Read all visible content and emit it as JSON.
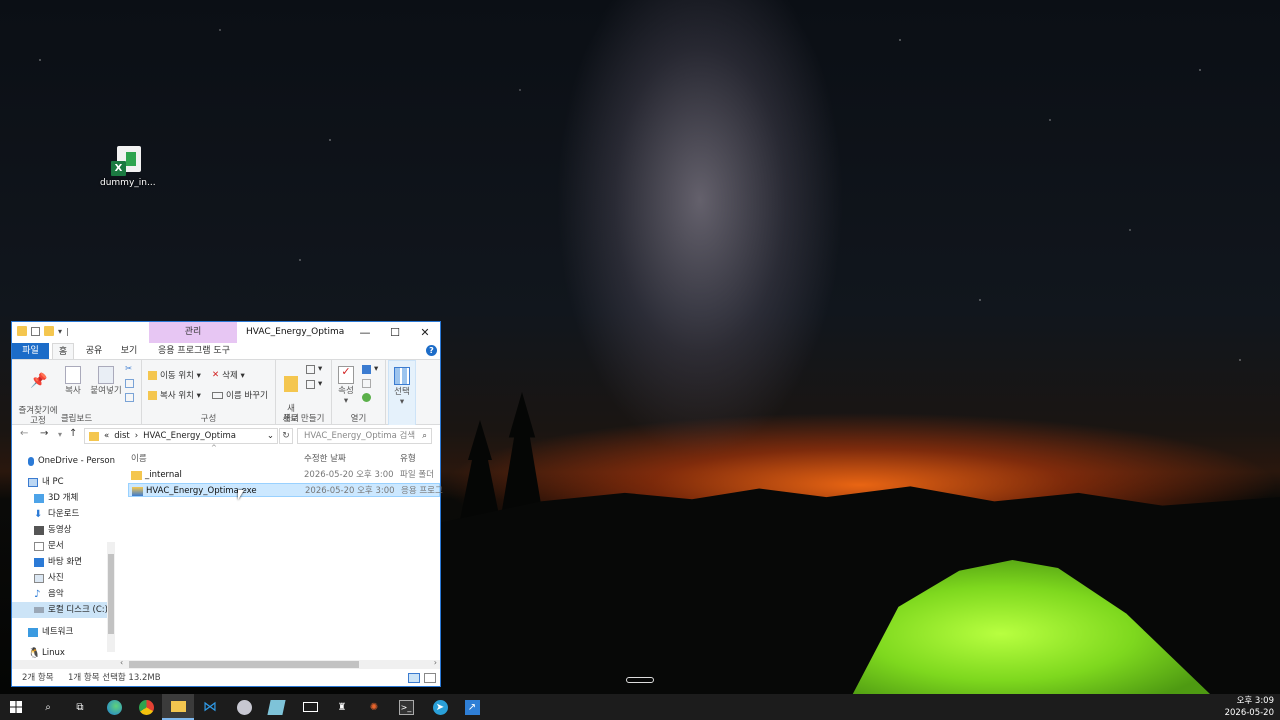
{
  "desktop": {
    "icon_label": "dummy_in..."
  },
  "window": {
    "context_tab": "관리",
    "title": "HVAC_Energy_Optima",
    "buttons": {
      "minimize": "—",
      "maximize": "☐",
      "close": "✕"
    },
    "tabs": [
      "파일",
      "홈",
      "공유",
      "보기",
      "응용 프로그램 도구"
    ],
    "ribbon": {
      "clipboard": {
        "pin": "즐겨찾기에\n고정",
        "copy": "복사",
        "paste": "붙여넣기",
        "group": "클립보드"
      },
      "organize": {
        "move": "이동 위치 ▾",
        "copy_to": "복사 위치 ▾",
        "delete": "삭제 ▾",
        "rename": "이름 바꾸기",
        "group": "구성"
      },
      "new": {
        "folder": "새\n폴더",
        "group": "새로 만들기"
      },
      "open": {
        "properties": "속성",
        "group": "열기"
      },
      "select": {
        "label": "선택"
      }
    },
    "address": {
      "prefix": "«",
      "crumbs": [
        "dist",
        "HVAC_Energy_Optima"
      ],
      "search_placeholder": "HVAC_Energy_Optima 검색"
    },
    "nav_items": [
      {
        "label": "OneDrive - Person",
        "icon": "cloud-icon"
      },
      {
        "label": "내 PC",
        "icon": "pc-icon"
      },
      {
        "label": "3D 개체",
        "icon": "cube-icon"
      },
      {
        "label": "다운로드",
        "icon": "download-icon"
      },
      {
        "label": "동영상",
        "icon": "video-icon"
      },
      {
        "label": "문서",
        "icon": "document-icon"
      },
      {
        "label": "바탕 화면",
        "icon": "desktop-icon"
      },
      {
        "label": "사진",
        "icon": "picture-icon"
      },
      {
        "label": "음악",
        "icon": "music-icon"
      },
      {
        "label": "로컬 디스크 (C:)",
        "icon": "disk-icon"
      },
      {
        "label": "네트워크",
        "icon": "network-icon"
      },
      {
        "label": "Linux",
        "icon": "linux-icon"
      }
    ],
    "columns": {
      "name": "이름",
      "date": "수정한 날짜",
      "type": "유형"
    },
    "files": [
      {
        "name": "_internal",
        "date": "2026-05-20 오후 3:00",
        "type": "파일 폴더",
        "icon": "folder-icon"
      },
      {
        "name": "HVAC_Energy_Optima.exe",
        "date": "2026-05-20 오후 3:00",
        "type": "응용 프로그",
        "icon": "exe-icon"
      }
    ],
    "status": {
      "count": "2개 항목",
      "selected": "1개 항목 선택함 13.2MB"
    }
  },
  "taskbar": {
    "time": "오후 3:09",
    "date": "2026-05-20"
  }
}
